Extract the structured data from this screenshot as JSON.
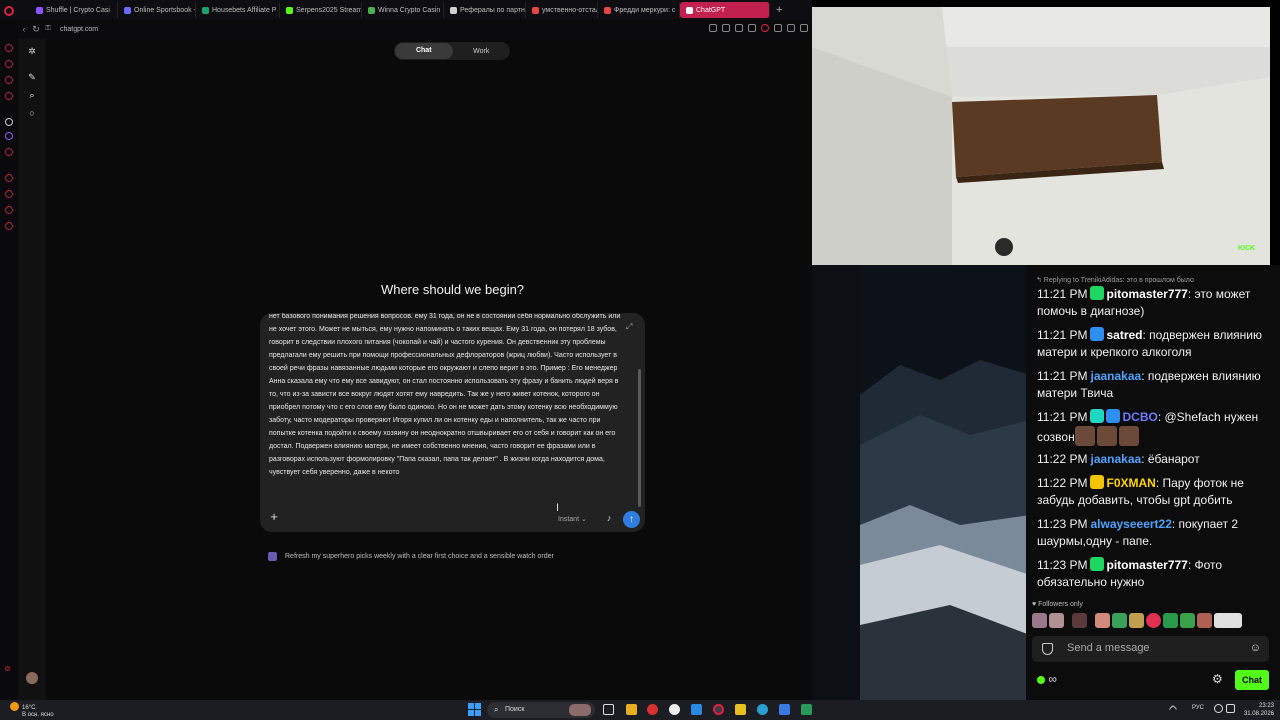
{
  "browser": {
    "tabs": [
      {
        "label": "Shuffle | Crypto Casi",
        "color": "#8a55ff"
      },
      {
        "label": "Online Sportsbook - ",
        "color": "#6b6bff"
      },
      {
        "label": "Housebets Affiliate P",
        "color": "#1aa36b"
      },
      {
        "label": "Serpens2025 Stream",
        "color": "#53fc18"
      },
      {
        "label": "Winna Crypto Casin",
        "color": "#4caf50"
      },
      {
        "label": "Рефералы по партн",
        "color": "#d0d0d0"
      },
      {
        "label": "умственно-отстал",
        "color": "#e84545"
      },
      {
        "label": "Фредди меркури: с",
        "color": "#e84545"
      },
      {
        "label": "ChatGPT",
        "color": "#ffffff",
        "active": true
      }
    ],
    "new_tab": "+",
    "url": "chatgpt.com"
  },
  "chatgpt": {
    "mode_chat": "Chat",
    "mode_work": "Work",
    "heading": "Where should we begin?",
    "composer_text": "нет базового понимания решения вопросов. ему 31 года, он не в состоянии себя нормально обслужить или не хочет этого. Может не мыться, ему нужно напоминать о таких вещах. Ему 31 года, он потерял 18 зубов, говорит в следствии плохого питания (чокопай и чай) и частого курения. Он девственник эту проблемы предлагали ему решить при помощи профессиональных дефлораторов (жриц любви). Часто использует в своей речи фразы навязанные людьми которые его окружают и слепо верит в это. Пример : Его менеджер Анна сказала ему что ему все завидуют, он стал постоянно использовать эту фразу и банить людей веря в то, что из-за зависти все вокруг людят хотят ему навредить. Так же у него живет котенок, которого он приобрел потому что с его слов ему было одиноко. Но он не может дать этому котенку всю необходиммую заботу, часто модераторы проверяют Игоря купил ли он котенку еды и наполнитель, так же часто при попытке котенка подойти к своему хозяину он неоднократно отшвыривает его от себя и говорит как он его достал. Подвержен влиянию матери, не имеет собственно мнения, часто говорит ее фразами или в разговорах используют формолировку \"Папа сказал, папа так делает\" . В жизни когда находится дома, чувствует себя уверенно, даже в некото",
    "model": "Instant ⌄",
    "plus": "+",
    "send": "↑",
    "suggestion": "Refresh my superhero picks weekly with a clear first choice and a sensible watch order"
  },
  "stream": {
    "kick_badge": "KICK",
    "reply_line": "↰ Replying to TrenikiAdidas: это в прошлом было",
    "messages": [
      {
        "time": "11:21 PM",
        "badges": [
          "#1ed760"
        ],
        "user": "pitomaster777",
        "user_color": "#ffffff",
        "text": ": это может помочь в диагнозе)"
      },
      {
        "time": "11:21 PM",
        "badges": [
          "#2f8ff0"
        ],
        "user": "satred",
        "user_color": "#ffffff",
        "text": ": подвержен влиянию матери и крепкого алкоголя"
      },
      {
        "time": "11:21 PM",
        "badges": [],
        "user": "jaanakaa",
        "user_color": "#4ea3ff",
        "text": ": подвержен влиянию матери Твича"
      },
      {
        "time": "11:21 PM",
        "badges": [
          "#1ed7c0",
          "#2f8ff0"
        ],
        "user": "DCBO",
        "user_color": "#6b7bff",
        "text": ": @Shefach нужен созвон"
      },
      {
        "time": "11:22 PM",
        "badges": [],
        "user": "jaanakaa",
        "user_color": "#4ea3ff",
        "text": ": ёбанарот"
      },
      {
        "time": "11:22 PM",
        "badges": [
          "#f3c400"
        ],
        "user": "F0XMAN",
        "user_color": "#ffd400",
        "text": ": Пару фоток не забудь добавить, чтобы gpt добить"
      },
      {
        "time": "11:23 PM",
        "badges": [],
        "user": "alwayseeert22",
        "user_color": "#4ea3ff",
        "text": ": покупает 2 шаурмы,одну - папе."
      },
      {
        "time": "11:23 PM",
        "badges": [
          "#1ed760"
        ],
        "user": "pitomaster777",
        "user_color": "#ffffff",
        "text": ": Фото обязательно нужно"
      }
    ],
    "followers_only": "♥ Followers only",
    "input_placeholder": "Send a message",
    "infinity": "∞",
    "chat_button": "Chat"
  },
  "taskbar": {
    "temp": "16°C",
    "weather_desc": "В осн. ясно",
    "search": "Поиск",
    "lang": "РУС",
    "time": "23:23",
    "date": "31.08.2026"
  }
}
